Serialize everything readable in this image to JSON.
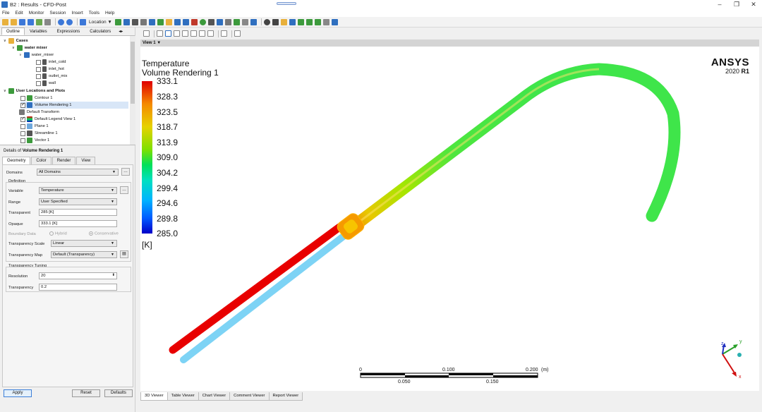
{
  "window": {
    "title": "B2 : Results - CFD-Post",
    "minimize": "–",
    "maximize": "❐",
    "close": "✕"
  },
  "menu": [
    "File",
    "Edit",
    "Monitor",
    "Session",
    "Insert",
    "Tools",
    "Help"
  ],
  "toolbar": {
    "location_label": "Location ▼"
  },
  "left_panel": {
    "tabs": [
      "Outline",
      "Variables",
      "Expressions",
      "Calculators"
    ],
    "tree": {
      "cases": "Cases",
      "case_name": "water mixer",
      "domain": "water_mixer",
      "regions": [
        "inlet_cold",
        "inlet_hot",
        "outlet_mix",
        "wall"
      ],
      "user_locations": "User Locations and Plots",
      "items": [
        "Contour 1",
        "Volume Rendering 1",
        "Default Transform",
        "Default Legend View 1",
        "Plane 1",
        "Streamline 1",
        "Vector 1"
      ]
    },
    "details": {
      "prefix": "Details of ",
      "object": "Volume Rendering 1",
      "tabs": [
        "Geometry",
        "Color",
        "Render",
        "View"
      ],
      "domains_label": "Domains",
      "domains_value": "All Domains",
      "definition_label": "Definition",
      "variable_label": "Variable",
      "variable_value": "Temperature",
      "range_label": "Range",
      "range_value": "User Specified",
      "transparent_label": "Transparent",
      "transparent_value": "285 [K]",
      "opaque_label": "Opaque",
      "opaque_value": "333.1 [K]",
      "boundary_label": "Boundary Data",
      "hybrid_label": "Hybrid",
      "conservative_label": "Conservative",
      "transparency_scale_label": "Transparency Scale",
      "transparency_scale_value": "Linear",
      "transparency_map_label": "Transparency Map",
      "transparency_map_value": "Default (Transparency)",
      "tuning_label": "Transparency Tuning",
      "resolution_label": "Resolution",
      "resolution_value": "20",
      "transparency_label": "Transparency",
      "transparency_value": "0.2"
    },
    "buttons": {
      "apply": "Apply",
      "reset": "Reset",
      "defaults": "Defaults"
    }
  },
  "viewer": {
    "view_name": "View 1 ▼",
    "legend": {
      "variable": "Temperature",
      "object": "Volume Rendering 1",
      "ticks": [
        "333.1",
        "328.3",
        "323.5",
        "318.7",
        "313.9",
        "309.0",
        "304.2",
        "299.4",
        "294.6",
        "289.8",
        "285.0"
      ],
      "unit": "[K]"
    },
    "brand": "ANSYS",
    "version": "2020",
    "release": "R1",
    "scale": {
      "top": [
        "0",
        "0.100",
        "0.200",
        "(m)"
      ],
      "bottom": [
        "0.050",
        "0.150"
      ]
    },
    "axes": {
      "x": "x",
      "y": "y",
      "z": "z"
    },
    "tabs": [
      "3D Viewer",
      "Table Viewer",
      "Chart Viewer",
      "Comment Viewer",
      "Report Viewer"
    ]
  },
  "colors": {
    "hot": "#e80000",
    "cold": "#7dd3f5",
    "mixed": "#3fe54a",
    "accent": "#2f6fbf"
  }
}
